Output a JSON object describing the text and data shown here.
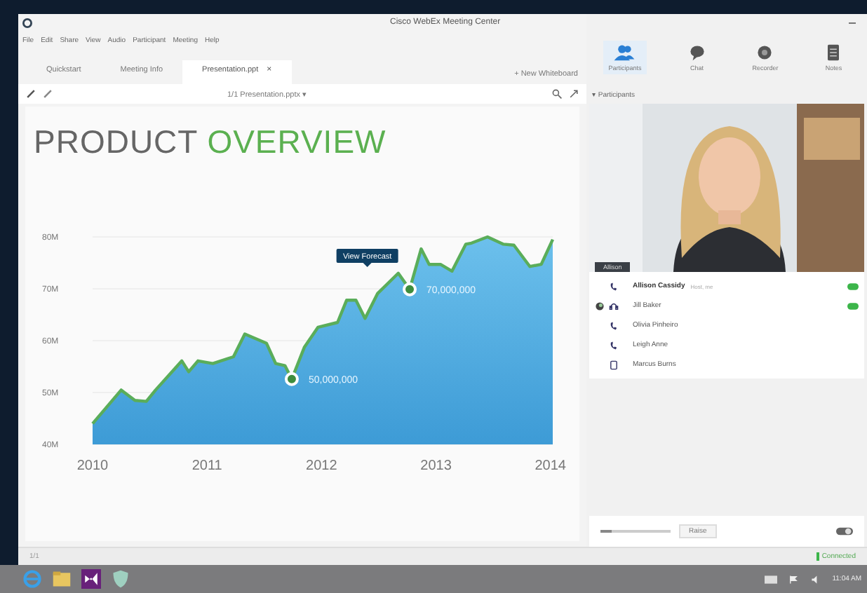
{
  "window": {
    "title": "Cisco WebEx Meeting Center"
  },
  "menu": [
    "File",
    "Edit",
    "Share",
    "View",
    "Audio",
    "Participant",
    "Meeting",
    "Help"
  ],
  "tabs": [
    {
      "label": "Quickstart",
      "selected": false
    },
    {
      "label": "Meeting Info",
      "selected": false
    },
    {
      "label": "Presentation.ppt",
      "selected": true,
      "close": "×"
    }
  ],
  "new_whiteboard": "+ New Whiteboard",
  "page_selector": "1/1 Presentation.pptx ▾",
  "slide": {
    "title_main": "PRODUCT",
    "title_accent": "OVERVIEW",
    "tooltip": "View Forecast",
    "chart_data": {
      "type": "area",
      "x": [
        2010,
        2010.25,
        2010.37,
        2010.47,
        2010.55,
        2010.78,
        2010.84,
        2010.92,
        2011.05,
        2011.23,
        2011.33,
        2011.52,
        2011.6,
        2011.68,
        2011.74,
        2011.85,
        2011.97,
        2012.14,
        2012.22,
        2012.3,
        2012.38,
        2012.49,
        2012.67,
        2012.77,
        2012.87,
        2012.94,
        2013.04,
        2013.14,
        2013.26,
        2013.31,
        2013.45,
        2013.59,
        2013.68,
        2013.82,
        2013.92,
        2014.02
      ],
      "series": [
        {
          "color": "#5aad5a",
          "values": [
            44,
            50.5,
            48.5,
            48.3,
            50.5,
            56.1,
            54,
            56.1,
            55.6,
            56.9,
            61.3,
            59.5,
            55.6,
            55.2,
            52.6,
            58.7,
            62.6,
            63.5,
            67.8,
            67.8,
            64.3,
            69.1,
            73,
            69.9,
            77.7,
            74.7,
            74.7,
            73.4,
            78.6,
            78.8,
            80,
            78.6,
            78.4,
            74.3,
            74.7,
            79.5
          ]
        }
      ],
      "xlim": [
        2010,
        2014.02
      ],
      "ylim": [
        40,
        80
      ],
      "grid": true,
      "xticks": [
        2010,
        2011,
        2012,
        2013,
        2014
      ],
      "yticks": [
        {
          "value": 40,
          "label": "40M"
        },
        {
          "value": 50,
          "label": "50M"
        },
        {
          "value": 60,
          "label": "60M"
        },
        {
          "value": 70,
          "label": "70M"
        },
        {
          "value": 80,
          "label": "80M"
        }
      ],
      "annotations": [
        {
          "x": 2011.74,
          "y": 52.6,
          "text": "50,000,000"
        },
        {
          "x": 2012.77,
          "y": 69.9,
          "text": "70,000,000"
        }
      ]
    }
  },
  "panel_tabs": [
    {
      "label": "Participants",
      "kind": "people",
      "selected": true
    },
    {
      "label": "Chat",
      "kind": "chat",
      "selected": false
    },
    {
      "label": "Recorder",
      "kind": "record",
      "selected": false
    },
    {
      "label": "Notes",
      "kind": "notes",
      "selected": false
    }
  ],
  "participants_header": "▾ Participants",
  "video": {
    "kind": "picture",
    "caption": "Allison"
  },
  "participants": [
    {
      "name": "Allison Cassidy",
      "note": "Host, me",
      "kind": "phone",
      "presenter": false,
      "mic_on": true
    },
    {
      "name": "Jill Baker",
      "kind": "headset",
      "presenter": true,
      "mic_on": true
    },
    {
      "name": "Olivia Pinheiro",
      "kind": "phone",
      "presenter": false,
      "mic_on": false
    },
    {
      "name": "Leigh Anne",
      "kind": "phone",
      "presenter": false,
      "mic_on": false
    },
    {
      "name": "Marcus Burns",
      "kind": "device",
      "presenter": false,
      "mic_on": false
    }
  ],
  "volume": {
    "level": 0.15
  },
  "raise_button": "Raise",
  "status": {
    "left": "1/1",
    "right": "Connected"
  },
  "clock": "11:04 AM"
}
